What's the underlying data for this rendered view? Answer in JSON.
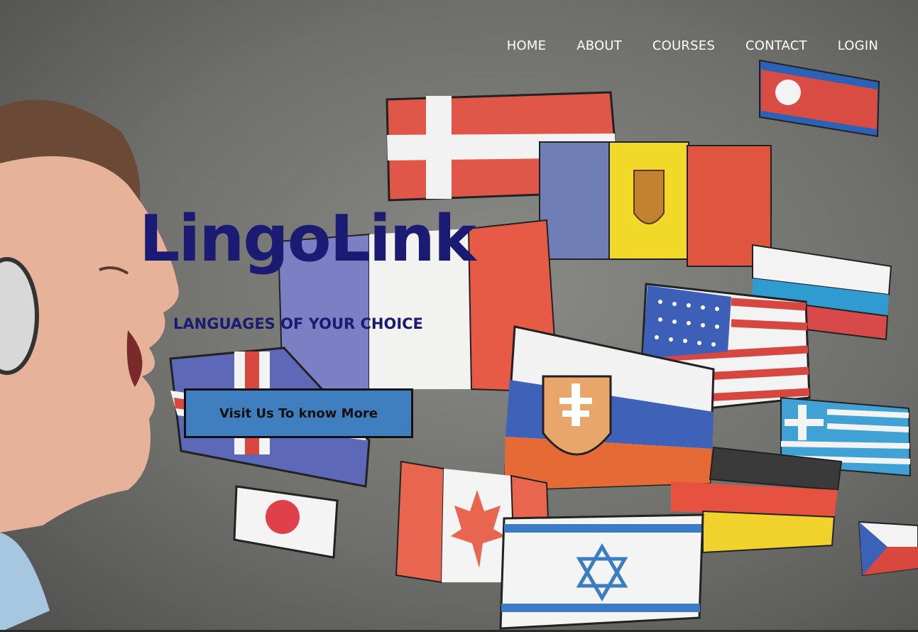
{
  "nav": {
    "items": [
      {
        "label": "HOME"
      },
      {
        "label": "ABOUT"
      },
      {
        "label": "COURSES"
      },
      {
        "label": "CONTACT"
      },
      {
        "label": "LOGIN"
      }
    ]
  },
  "hero": {
    "brand": "LingoLink",
    "tagline": "LANGUAGES OF YOUR CHOICE",
    "cta_label": "Visit Us To know More"
  },
  "colors": {
    "brand": "#1b1b73",
    "cta_background": "#3f7fbf",
    "nav_text": "#ffffff"
  }
}
